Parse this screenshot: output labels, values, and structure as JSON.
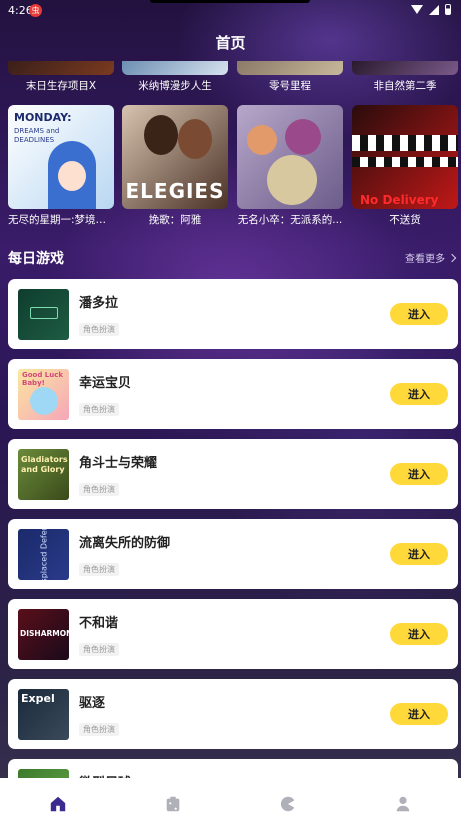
{
  "status": {
    "time": "4:26",
    "app_badge": "虫"
  },
  "header": {
    "title": "首页"
  },
  "top_row": [
    {
      "label": "末日生存项目X",
      "colors": [
        "#3a1f1a",
        "#7b3a20"
      ]
    },
    {
      "label": "米纳博漫步人生",
      "colors": [
        "#6c8fb3",
        "#d7e2ee"
      ]
    },
    {
      "label": "零号里程",
      "colors": [
        "#8a7a68",
        "#c8b89a"
      ]
    },
    {
      "label": "非自然第二季",
      "colors": [
        "#2a1a2e",
        "#7a5a8a"
      ]
    }
  ],
  "featured": [
    {
      "label": "无尽的星期一:梦境与...",
      "cover_text_1": "MONDAY:",
      "cover_text_2": "DREAMS and DEADLINES",
      "colors": [
        "#ffffff",
        "#b9d7f2"
      ]
    },
    {
      "label": "挽歌：阿雅",
      "cover_text_1": "ELEGIES",
      "cover_text_2": "",
      "colors": [
        "#d7c3b0",
        "#4a3226"
      ]
    },
    {
      "label": "无名小卒：无派系的...",
      "cover_text_1": "",
      "cover_text_2": "",
      "colors": [
        "#b7a7c9",
        "#6b5c8a"
      ]
    },
    {
      "label": "不送货",
      "cover_text_1": "No Delivery",
      "cover_text_2": "",
      "colors": [
        "#2a0c0c",
        "#c01818"
      ]
    }
  ],
  "daily": {
    "title": "每日游戏",
    "see_more": "查看更多"
  },
  "games": [
    {
      "name": "潘多拉",
      "tag": "角色扮演",
      "button": "进入",
      "thumb_text": "",
      "colors": [
        "#0f3d2e",
        "#1d5c44"
      ]
    },
    {
      "name": "幸运宝贝",
      "tag": "角色扮演",
      "button": "进入",
      "thumb_text": "Good Luck Baby!",
      "colors": [
        "#fbe6a0",
        "#f6a6b8"
      ]
    },
    {
      "name": "角斗士与荣耀",
      "tag": "角色扮演",
      "button": "进入",
      "thumb_text": "Gladiators and Glory",
      "colors": [
        "#6a8b3a",
        "#3a4a1a"
      ]
    },
    {
      "name": "流离失所的防御",
      "tag": "角色扮演",
      "button": "进入",
      "thumb_text": "Displaced Defense",
      "colors": [
        "#1a2a6a",
        "#2a3a8a"
      ]
    },
    {
      "name": "不和谐",
      "tag": "角色扮演",
      "button": "进入",
      "thumb_text": "DISHARMONY",
      "colors": [
        "#5a0f1a",
        "#1a0a1a"
      ]
    },
    {
      "name": "驱逐",
      "tag": "角色扮演",
      "button": "进入",
      "thumb_text": "Expel",
      "colors": [
        "#1a2a3a",
        "#3a4a5a"
      ]
    },
    {
      "name": "微型足球",
      "tag": "",
      "button": "",
      "thumb_text": "",
      "colors": [
        "#3a7a2a",
        "#6aa84a"
      ]
    }
  ],
  "tabs": [
    {
      "icon": "home-icon",
      "active": true
    },
    {
      "icon": "dice-icon",
      "active": false
    },
    {
      "icon": "pacman-icon",
      "active": false
    },
    {
      "icon": "user-icon",
      "active": false
    }
  ],
  "theme": {
    "accent": "#ffd83a",
    "active_tab": "#3b2a8f",
    "inactive_tab": "#b0b0b8"
  }
}
